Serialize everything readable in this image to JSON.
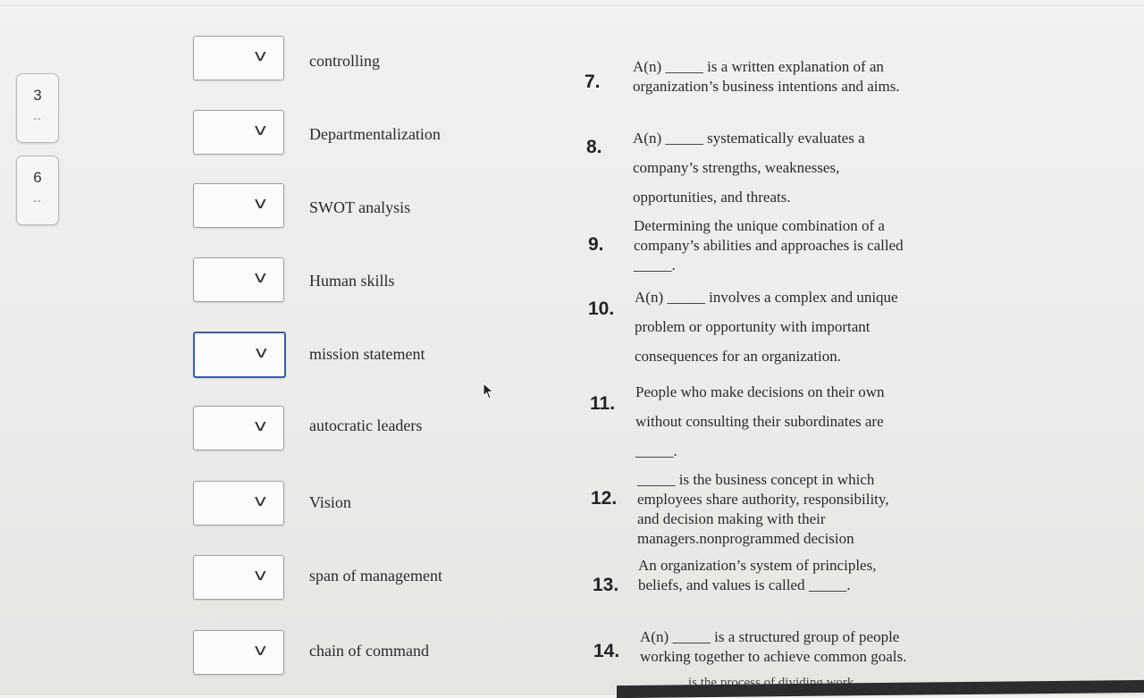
{
  "nav": [
    {
      "number": "3",
      "dashes": "--"
    },
    {
      "number": "6",
      "dashes": "--"
    }
  ],
  "answers": [
    {
      "term": "controlling",
      "chevron": "v"
    },
    {
      "term": "Departmentalization",
      "chevron": "v"
    },
    {
      "term": "SWOT analysis",
      "chevron": "v"
    },
    {
      "term": "Human skills",
      "chevron": "v"
    },
    {
      "term": "mission statement",
      "chevron": "v"
    },
    {
      "term": "autocratic leaders",
      "chevron": "v"
    },
    {
      "term": "Vision",
      "chevron": "v"
    },
    {
      "term": "span of management",
      "chevron": "v"
    },
    {
      "term": "chain of command",
      "chevron": "v"
    }
  ],
  "questions": [
    {
      "number": "7.",
      "lines": [
        "A(n) _____ is a written explanation of an",
        "organization’s business intentions and aims."
      ]
    },
    {
      "number": "8.",
      "lines": [
        "A(n) _____ systematically evaluates a",
        "company’s strengths, weaknesses,",
        "opportunities, and threats."
      ]
    },
    {
      "number": "9.",
      "lines": [
        "Determining the unique combination of a",
        "company’s abilities and approaches is called",
        "_____."
      ]
    },
    {
      "number": "10.",
      "lines": [
        "A(n) _____ involves a complex and unique",
        "problem or opportunity with important",
        "consequences for an organization."
      ]
    },
    {
      "number": "11.",
      "lines": [
        "People who make decisions on their own",
        "without consulting their subordinates are",
        "_____."
      ]
    },
    {
      "number": "12.",
      "lines": [
        "_____ is the business concept in which",
        "employees share authority, responsibility,",
        "and decision making with their",
        "managers.nonprogrammed decision"
      ]
    },
    {
      "number": "13.",
      "lines": [
        "An organization’s system of principles,",
        "beliefs, and values is called _____."
      ]
    },
    {
      "number": "14.",
      "lines": [
        "A(n) _____ is a structured group of people",
        "working together to achieve common goals."
      ]
    }
  ],
  "bottom_peek": "is the process of dividing work"
}
